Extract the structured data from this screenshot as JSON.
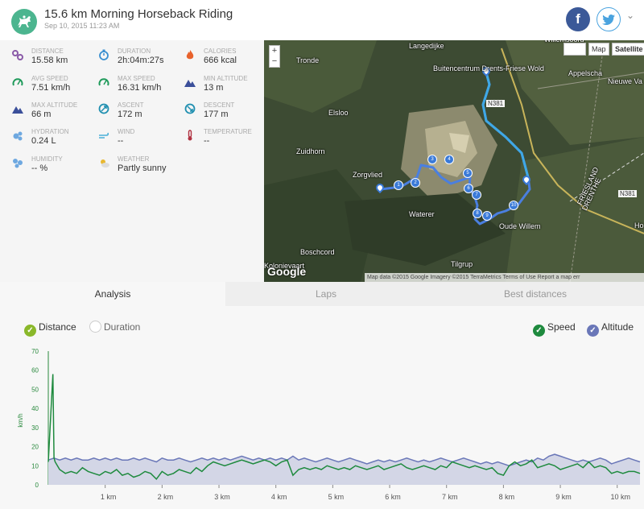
{
  "header": {
    "title": "15.6 km Morning Horseback Riding",
    "subtitle": "Sep 10, 2015 11:23 AM",
    "facebook_glyph": "f",
    "more_glyph": "⌄"
  },
  "stats": [
    {
      "label": "DISTANCE",
      "value": "15.58 km",
      "icon": "distance-icon",
      "color": "#8a5aa8"
    },
    {
      "label": "DURATION",
      "value": "2h:04m:27s",
      "icon": "stopwatch-icon",
      "color": "#3a8fd0"
    },
    {
      "label": "CALORIES",
      "value": "666 kcal",
      "icon": "flame-icon",
      "color": "#e8622c"
    },
    {
      "label": "AVG SPEED",
      "value": "7.51 km/h",
      "icon": "speedometer-icon",
      "color": "#1e9a5a"
    },
    {
      "label": "MAX SPEED",
      "value": "16.31 km/h",
      "icon": "speedometer-icon",
      "color": "#1e9a5a"
    },
    {
      "label": "MIN ALTITUDE",
      "value": "13 m",
      "icon": "mountain-icon",
      "color": "#3b4f9a"
    },
    {
      "label": "MAX ALTITUDE",
      "value": "66 m",
      "icon": "mountain-icon",
      "color": "#3b4f9a"
    },
    {
      "label": "ASCENT",
      "value": "172 m",
      "icon": "ascent-icon",
      "color": "#1f8fb0"
    },
    {
      "label": "DESCENT",
      "value": "177 m",
      "icon": "descent-icon",
      "color": "#1f8fb0"
    },
    {
      "label": "HYDRATION",
      "value": "0.24 L",
      "icon": "water-drops-icon",
      "color": "#6ea8e0"
    },
    {
      "label": "WIND",
      "value": "--",
      "icon": "wind-icon",
      "color": "#4bb0d8"
    },
    {
      "label": "TEMPERATURE",
      "value": "--",
      "icon": "thermometer-icon",
      "color": "#b03040"
    },
    {
      "label": "HUMIDITY",
      "value": "-- %",
      "icon": "humidity-icon",
      "color": "#6ea8e0"
    },
    {
      "label": "WEATHER",
      "value": "Partly sunny",
      "icon": "partly-sunny-icon",
      "color": "#e8b830"
    }
  ],
  "map": {
    "zoom_in": "+",
    "zoom_out": "−",
    "map_button": "Map",
    "satellite_button": "Satellite",
    "labels": [
      "Langedijke",
      "Tronde",
      "Buitencentrum Drents-Friese Wold",
      "Appelscha",
      "Elsloo",
      "Zuidhorn",
      "Zorgvlied",
      "Waterer",
      "Oude Willem",
      "Boschcord",
      "FRIESLAND",
      "DRENTHE",
      "N381",
      "N381",
      "Nieuwe Va",
      "Tilgrup",
      "Kolonievaart",
      "Willemsoord",
      "Ho"
    ],
    "google": "Google",
    "attribution": "Map data ©2015 Google Imagery ©2015 TerraMetrics   Terms of Use   Report a map err",
    "markers": [
      "1",
      "2",
      "3",
      "4",
      "5",
      "6",
      "7",
      "8",
      "9",
      "10"
    ]
  },
  "tabs": [
    {
      "label": "Analysis",
      "active": true
    },
    {
      "label": "Laps",
      "active": false
    },
    {
      "label": "Best distances",
      "active": false
    }
  ],
  "toggles": {
    "distance": "Distance",
    "duration": "Duration",
    "speed": "Speed",
    "altitude": "Altitude",
    "check": "✓"
  },
  "colors": {
    "speed": "#1e8a3e",
    "altitude": "#6a77b8",
    "altitude_fill": "#d3d6e6",
    "axis_text": "#2a8a3e",
    "route": "#4a7fe0",
    "route_light": "#3fa8e6",
    "distance_toggle": "#8ab82a"
  },
  "chart_data": {
    "type": "line",
    "ylabel": "km/h",
    "y_ticks": [
      0,
      10,
      20,
      30,
      40,
      50,
      60,
      70
    ],
    "ylim": [
      0,
      70
    ],
    "x_ticks": [
      "1 km",
      "2 km",
      "3 km",
      "4 km",
      "5 km",
      "6 km",
      "7 km",
      "8 km",
      "9 km",
      "10 km"
    ],
    "xlim": [
      0,
      10.4
    ],
    "series": [
      {
        "name": "Speed",
        "x": [
          0.0,
          0.08,
          0.1,
          0.12,
          0.2,
          0.3,
          0.4,
          0.5,
          0.6,
          0.7,
          0.8,
          0.9,
          1.0,
          1.1,
          1.2,
          1.3,
          1.4,
          1.5,
          1.6,
          1.7,
          1.8,
          1.9,
          2.0,
          2.1,
          2.2,
          2.3,
          2.4,
          2.5,
          2.6,
          2.7,
          2.8,
          2.9,
          3.0,
          3.1,
          3.2,
          3.3,
          3.4,
          3.5,
          3.6,
          3.7,
          3.8,
          3.9,
          4.0,
          4.1,
          4.2,
          4.3,
          4.4,
          4.5,
          4.6,
          4.7,
          4.8,
          4.9,
          5.0,
          5.1,
          5.2,
          5.3,
          5.4,
          5.5,
          5.6,
          5.7,
          5.8,
          5.9,
          6.0,
          6.1,
          6.2,
          6.3,
          6.4,
          6.5,
          6.6,
          6.7,
          6.8,
          6.9,
          7.0,
          7.1,
          7.2,
          7.3,
          7.4,
          7.5,
          7.6,
          7.7,
          7.8,
          7.9,
          8.0,
          8.1,
          8.2,
          8.3,
          8.4,
          8.5,
          8.6,
          8.7,
          8.8,
          8.9,
          9.0,
          9.1,
          9.2,
          9.3,
          9.4,
          9.5,
          9.6,
          9.7,
          9.8,
          9.9,
          10.0,
          10.1,
          10.2,
          10.3,
          10.4
        ],
        "values": [
          12,
          58,
          14,
          12,
          8,
          6,
          7,
          6,
          9,
          7,
          6,
          5,
          7,
          6,
          8,
          5,
          6,
          4,
          5,
          7,
          6,
          3,
          7,
          5,
          6,
          8,
          7,
          6,
          9,
          7,
          10,
          12,
          11,
          10,
          11,
          12,
          13,
          12,
          11,
          12,
          13,
          12,
          10,
          12,
          13,
          5,
          8,
          9,
          8,
          9,
          8,
          10,
          9,
          8,
          9,
          8,
          10,
          9,
          8,
          9,
          10,
          8,
          9,
          10,
          11,
          9,
          8,
          9,
          10,
          9,
          8,
          10,
          9,
          12,
          11,
          10,
          9,
          10,
          9,
          8,
          9,
          6,
          5,
          10,
          12,
          10,
          11,
          13,
          9,
          10,
          11,
          10,
          8,
          9,
          10,
          11,
          9,
          12,
          9,
          10,
          9,
          6,
          7,
          6,
          7,
          7,
          6
        ]
      },
      {
        "name": "Altitude",
        "x": [
          0.0,
          0.1,
          0.2,
          0.3,
          0.4,
          0.5,
          0.6,
          0.7,
          0.8,
          0.9,
          1.0,
          1.1,
          1.2,
          1.3,
          1.4,
          1.5,
          1.6,
          1.7,
          1.8,
          1.9,
          2.0,
          2.1,
          2.2,
          2.3,
          2.4,
          2.5,
          2.6,
          2.7,
          2.8,
          2.9,
          3.0,
          3.1,
          3.2,
          3.3,
          3.4,
          3.5,
          3.6,
          3.7,
          3.8,
          3.9,
          4.0,
          4.1,
          4.2,
          4.3,
          4.4,
          4.5,
          4.6,
          4.7,
          4.8,
          4.9,
          5.0,
          5.1,
          5.2,
          5.3,
          5.4,
          5.5,
          5.6,
          5.7,
          5.8,
          5.9,
          6.0,
          6.1,
          6.2,
          6.3,
          6.4,
          6.5,
          6.6,
          6.7,
          6.8,
          6.9,
          7.0,
          7.1,
          7.2,
          7.3,
          7.4,
          7.5,
          7.6,
          7.7,
          7.8,
          7.9,
          8.0,
          8.1,
          8.2,
          8.3,
          8.4,
          8.5,
          8.6,
          8.7,
          8.8,
          8.9,
          9.0,
          9.1,
          9.2,
          9.3,
          9.4,
          9.5,
          9.6,
          9.7,
          9.8,
          9.9,
          10.0,
          10.1,
          10.2,
          10.3,
          10.4
        ],
        "values": [
          13,
          14,
          13,
          14,
          13,
          14,
          13,
          13,
          14,
          13,
          14,
          13,
          14,
          13,
          13,
          14,
          13,
          14,
          13,
          12,
          14,
          13,
          13,
          14,
          13,
          12,
          13,
          14,
          13,
          14,
          13,
          14,
          13,
          14,
          15,
          14,
          13,
          14,
          13,
          14,
          13,
          14,
          13,
          15,
          13,
          14,
          13,
          12,
          13,
          14,
          13,
          12,
          13,
          14,
          13,
          12,
          11,
          12,
          13,
          12,
          13,
          12,
          13,
          14,
          13,
          12,
          13,
          12,
          13,
          14,
          13,
          12,
          13,
          14,
          13,
          12,
          11,
          12,
          11,
          12,
          11,
          10,
          11,
          12,
          13,
          12,
          14,
          13,
          15,
          16,
          15,
          14,
          13,
          12,
          13,
          12,
          13,
          14,
          13,
          11,
          12,
          13,
          14,
          13,
          12
        ]
      }
    ]
  }
}
